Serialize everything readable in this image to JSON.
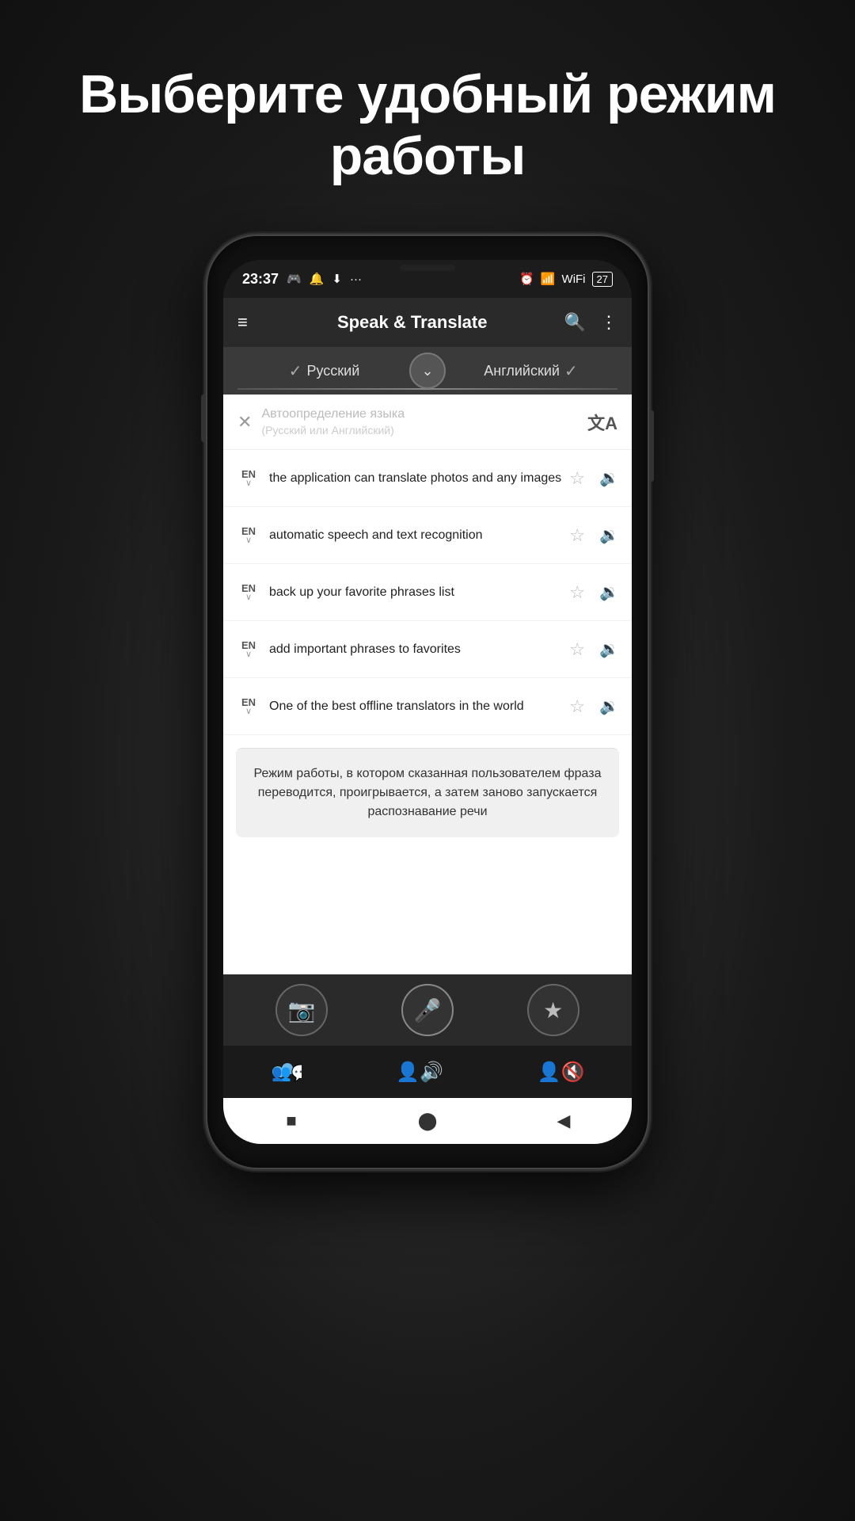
{
  "page": {
    "title_line1": "Выберите удобный режим",
    "title_line2": "работы"
  },
  "status_bar": {
    "time": "23:37",
    "left_icons": [
      "🎮",
      "🔔",
      "⬇",
      "···"
    ],
    "right_icons": [
      "⏰",
      "📶",
      "WiFi",
      "27"
    ]
  },
  "app_bar": {
    "title": "Speak & Translate",
    "menu_icon": "≡",
    "search_icon": "🔍",
    "more_icon": "⋮"
  },
  "lang_bar": {
    "lang_left": "Русский",
    "lang_right": "Английский",
    "check_left": "✓",
    "check_right": "✓",
    "swap_icon": "⌄"
  },
  "search_bar": {
    "close_icon": "✕",
    "placeholder_line1": "Автоопределение языка",
    "placeholder_line2": "(Русский или Английский)",
    "translate_icon": "文A"
  },
  "translations": [
    {
      "lang": "EN",
      "text": "the application can translate photos and any images"
    },
    {
      "lang": "EN",
      "text": "automatic speech and text recognition"
    },
    {
      "lang": "EN",
      "text": "back up your favorite phrases list"
    },
    {
      "lang": "EN",
      "text": "add important phrases to favorites"
    },
    {
      "lang": "EN",
      "text": "One of the best offline translators in the world"
    }
  ],
  "result_box": {
    "text": "Режим работы, в котором сказанная пользователем фраза переводится, проигрывается, а затем заново запускается распознавание речи"
  },
  "bottom_actions": {
    "camera_icon": "📷",
    "mic_icon": "🎤",
    "star_icon": "★"
  },
  "mode_tabs": [
    {
      "label": "",
      "icon": "👥💬",
      "active": true
    },
    {
      "label": "",
      "icon": "👤🔊",
      "active": false
    },
    {
      "label": "",
      "icon": "👤🔇",
      "active": false
    }
  ],
  "nav_bar": {
    "stop_icon": "■",
    "home_icon": "⬤",
    "back_icon": "◀"
  }
}
